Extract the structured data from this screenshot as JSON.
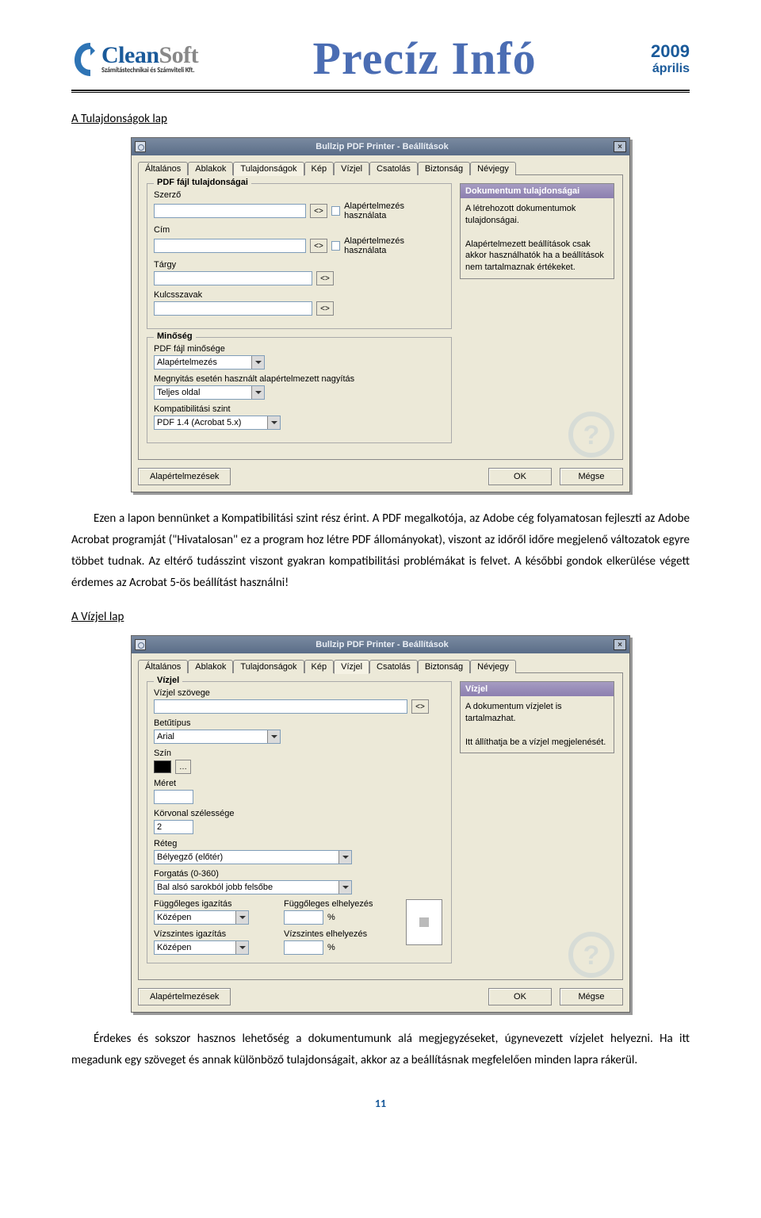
{
  "header": {
    "logo_company": "CleanSoft",
    "logo_tagline": "Számítástechnikai és Számviteli Kft.",
    "title": "Precíz Infó",
    "year": "2009",
    "month": "április"
  },
  "section1": {
    "title": "A Tulajdonságok lap",
    "caption": "Ezen a lapon bennünket a Kompatibilitási szint rész érint. A PDF megalkotója, az Adobe cég folyamatosan fejleszti az Adobe Acrobat programját (\"Hivatalosan\" ez a program hoz létre PDF állományokat), viszont az időről időre megjelenő változatok egyre többet tudnak. Az eltérő tudásszint viszont gyakran kompatibilitási problémákat is felvet. A későbbi gondok elkerülése végett érdemes az Acrobat 5-ös beállítást használni!"
  },
  "section2": {
    "title": "A Vízjel lap",
    "caption": "Érdekes és sokszor hasznos lehetőség a dokumentumunk alá megjegyzéseket, úgynevezett vízjelet helyezni. Ha itt megadunk egy szöveget és annak különböző tulajdonságait, akkor az a beállításnak megfelelően minden lapra rákerül."
  },
  "dialog": {
    "title": "Bullzip PDF Printer - Beállítások",
    "tabs": [
      "Általános",
      "Ablakok",
      "Tulajdonságok",
      "Kép",
      "Vízjel",
      "Csatolás",
      "Biztonság",
      "Névjegy"
    ],
    "props": {
      "group1": "PDF fájl tulajdonságai",
      "author": "Szerző",
      "title": "Cím",
      "subject": "Tárgy",
      "keywords": "Kulcsszavak",
      "use_default": "Alapértelmezés használata",
      "group2": "Minőség",
      "pdf_quality": "PDF fájl minősége",
      "pdf_quality_val": "Alapértelmezés",
      "default_zoom": "Megnyitás esetén használt alapértelmezett nagyítás",
      "default_zoom_val": "Teljes oldal",
      "compat": "Kompatibilitási szint",
      "compat_val": "PDF 1.4 (Acrobat 5.x)",
      "info_head": "Dokumentum tulajdonságai",
      "info_body1": "A létrehozott dokumentumok tulajdonságai.",
      "info_body2": "Alapértelmezett beállítások csak akkor használhatók ha a beállítások nem tartalmaznak értékeket."
    },
    "watermark": {
      "group": "Vízjel",
      "text": "Vízjel szövege",
      "font": "Betűtípus",
      "font_val": "Arial",
      "color": "Szín",
      "size": "Méret",
      "outline": "Körvonal szélessége",
      "outline_val": "2",
      "layer": "Réteg",
      "layer_val": "Bélyegző (előtér)",
      "rotation": "Forgatás (0-360)",
      "rotation_val": "Bal alsó sarokból jobb felsőbe",
      "valign": "Függőleges igazítás",
      "voffset": "Függőleges elhelyezés",
      "center": "Középen",
      "halign": "Vízszintes igazítás",
      "hoffset": "Vízszintes elhelyezés",
      "pct": "%",
      "info_head": "Vízjel",
      "info_body1": "A dokumentum vízjelet is tartalmazhat.",
      "info_body2": "Itt állíthatja be a vízjel megjelenését."
    },
    "btn_defaults": "Alapértelmezések",
    "btn_ok": "OK",
    "btn_cancel": "Mégse"
  },
  "page_number": "11"
}
